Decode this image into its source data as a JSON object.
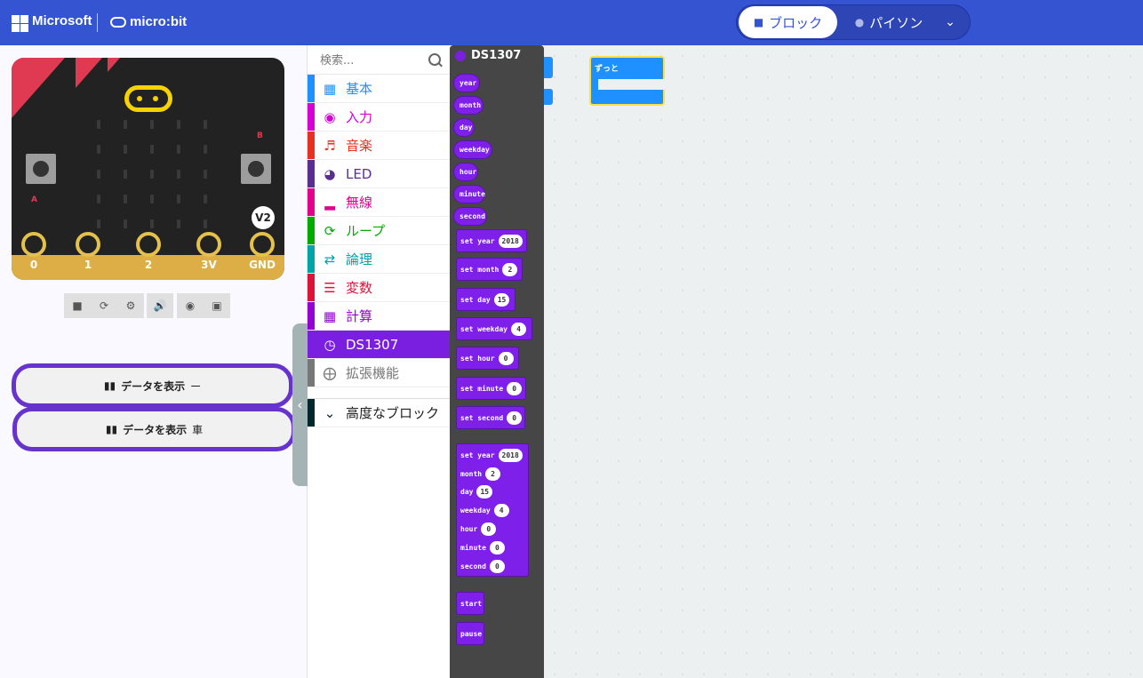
{
  "header": {
    "brand": "Microsoft",
    "product": "micro:bit",
    "tabs": {
      "blocks": "ブロック",
      "python": "パイソン"
    },
    "accent": "#3454d1"
  },
  "simulator": {
    "board_badge": "V2",
    "button_a": "A",
    "button_b": "B",
    "pins": [
      "0",
      "1",
      "2",
      "3V",
      "GND"
    ],
    "toolbar": [
      "stop-icon",
      "restart-icon",
      "debug-icon",
      "sound-icon",
      "screenshot-icon",
      "fullscreen-icon"
    ],
    "data_buttons": [
      {
        "label": "データを表示",
        "suffix": "ー"
      },
      {
        "label": "データを表示",
        "suffix": "車"
      }
    ]
  },
  "toolbox": {
    "search_placeholder": "検索...",
    "categories": [
      {
        "label": "基本",
        "color": "#1e90ff"
      },
      {
        "label": "入力",
        "color": "#d400d4"
      },
      {
        "label": "音楽",
        "color": "#e63022"
      },
      {
        "label": "LED",
        "color": "#5c2d91"
      },
      {
        "label": "無線",
        "color": "#e3008c"
      },
      {
        "label": "ループ",
        "color": "#00aa00"
      },
      {
        "label": "論理",
        "color": "#00a4a6"
      },
      {
        "label": "変数",
        "color": "#dc143c"
      },
      {
        "label": "計算",
        "color": "#9400d3"
      },
      {
        "label": "DS1307",
        "color": "#7a1fe0"
      },
      {
        "label": "拡張機能",
        "color": "#777777"
      },
      {
        "label": "高度なブロック",
        "color": "#00272b"
      }
    ]
  },
  "flyout": {
    "title": "DS1307",
    "reporters": [
      "year",
      "month",
      "day",
      "weekday",
      "hour",
      "minute",
      "second"
    ],
    "setters": [
      {
        "label": "set year",
        "value": "2018"
      },
      {
        "label": "set month",
        "value": "2"
      },
      {
        "label": "set day",
        "value": "15"
      },
      {
        "label": "set weekday",
        "value": "4"
      },
      {
        "label": "set hour",
        "value": "0"
      },
      {
        "label": "set minute",
        "value": "0"
      },
      {
        "label": "set second",
        "value": "0"
      }
    ],
    "combined": [
      {
        "label": "set year",
        "value": "2018"
      },
      {
        "label": "month",
        "value": "2"
      },
      {
        "label": "day",
        "value": "15"
      },
      {
        "label": "weekday",
        "value": "4"
      },
      {
        "label": "hour",
        "value": "0"
      },
      {
        "label": "minute",
        "value": "0"
      },
      {
        "label": "second",
        "value": "0"
      }
    ],
    "actions": [
      "start",
      "pause"
    ]
  },
  "workspace": {
    "forever_label": "ずっと"
  }
}
